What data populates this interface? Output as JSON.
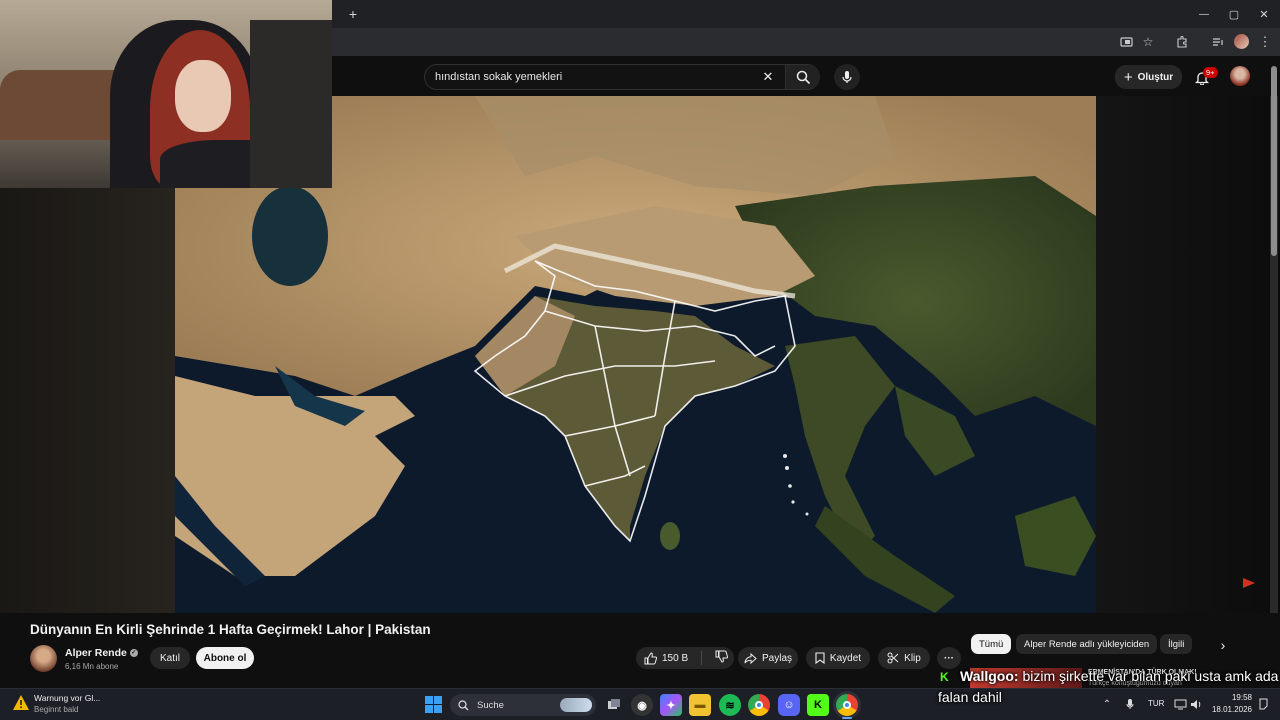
{
  "browser": {
    "new_tab_label": "+",
    "win_min": "—",
    "win_max": "▢",
    "win_close": "✕"
  },
  "youtube": {
    "search_value": "hındıstan sokak yemekleri",
    "create_label": "Oluştur",
    "notif_badge": "9+"
  },
  "video": {
    "title": "Dünyanın En Kirli Şehrinde 1 Hafta Geçirmek! Lahor | Pakistan"
  },
  "channel": {
    "name": "Alper Rende",
    "subs": "6,16 Mn abone",
    "join_label": "Katıl",
    "subscribe_label": "Abone ol"
  },
  "actions": {
    "like_count": "150 B",
    "share_label": "Paylaş",
    "save_label": "Kaydet",
    "clip_label": "Klip",
    "more_label": "···"
  },
  "chips": [
    "Tümü",
    "Alper Rende adlı yükleyiciden",
    "İlgili"
  ],
  "overlay": {
    "chat_user": "Wallgoo:",
    "chat_line1": "bizim şirkette var bilan paki usta amk ada",
    "chat_line2": "falan dahil",
    "ticker_line1": "ERMENİSTAN'DA TÜRK OLMAK!",
    "ticker_line2": "Türkçe konuştuğumuzu duyan"
  },
  "taskbar": {
    "notif_title": "Warnung vor Gl...",
    "notif_sub": "Beginnt bald",
    "search_label": "Suche",
    "lang": "TUR",
    "time": "19:58",
    "date": "18.01.2026"
  }
}
